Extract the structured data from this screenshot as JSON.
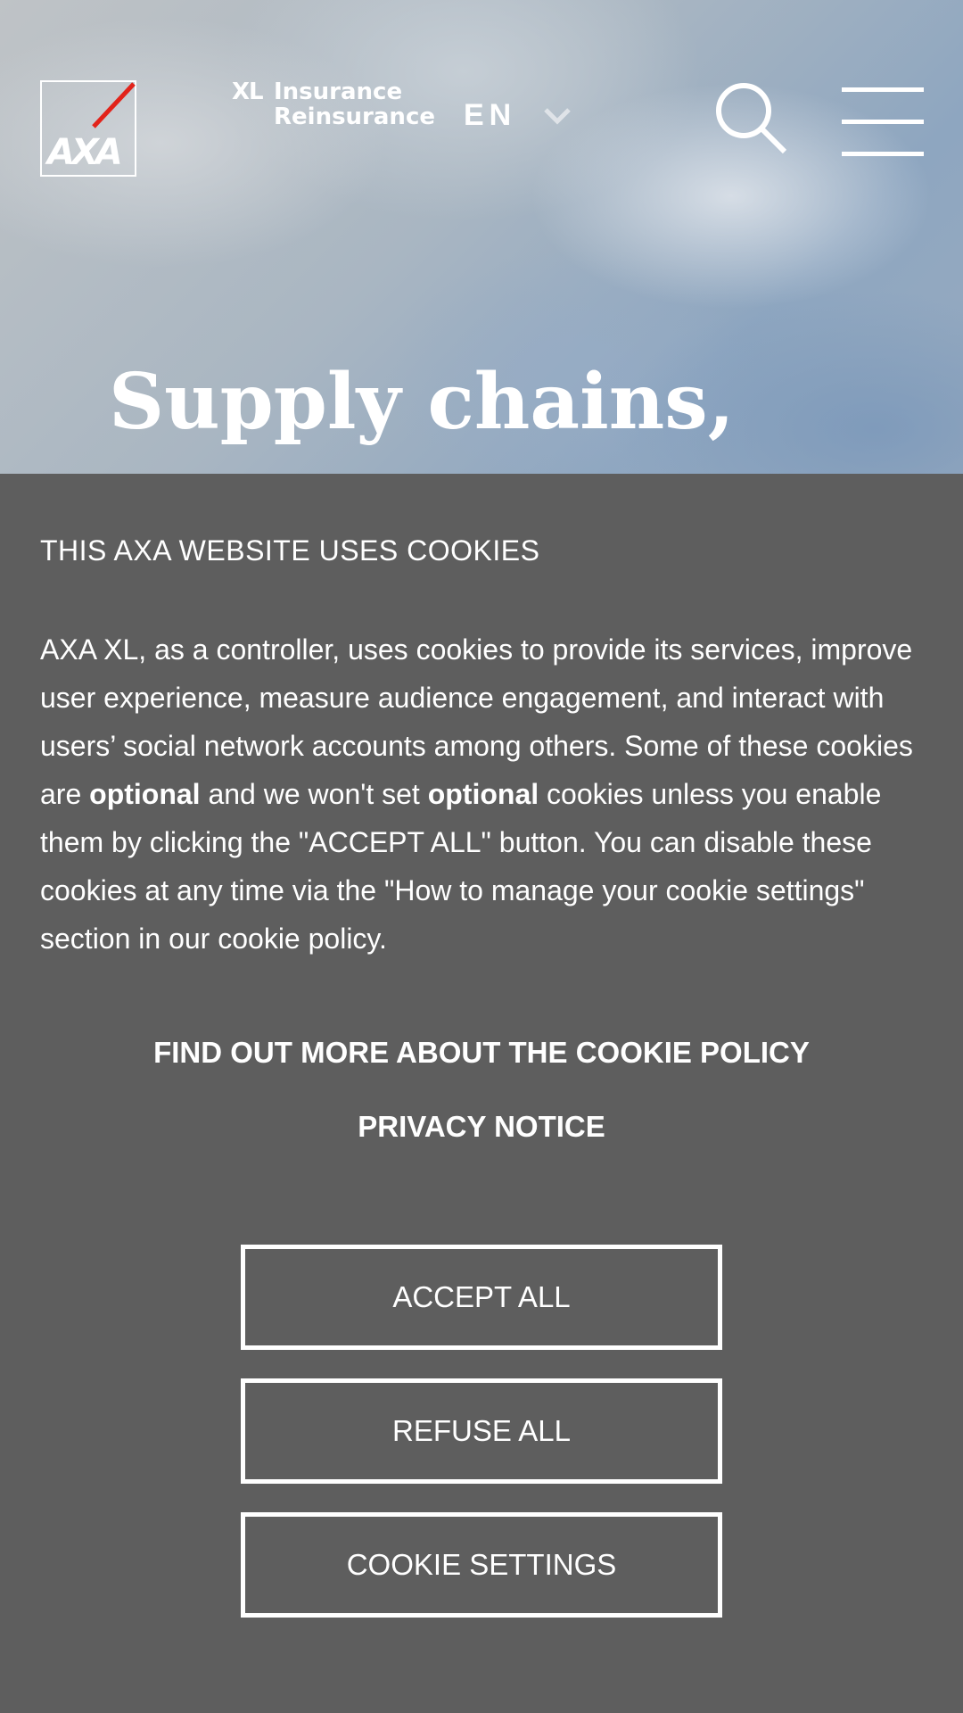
{
  "header": {
    "logo_text": "AXA",
    "logo_accent_color": "#e2231a",
    "brand_mark": "XL",
    "brand_line1": "Insurance",
    "brand_line2": "Reinsurance",
    "language": "EN",
    "language_icon": "chevron-down-icon",
    "search_icon": "search-icon",
    "menu_icon": "hamburger-menu-icon"
  },
  "hero": {
    "title": "Supply chains, inflation and"
  },
  "cookie_banner": {
    "heading": "THIS AXA WEBSITE USES COOKIES",
    "body_part1": "AXA XL, as a controller, uses cookies to provide its services, improve user experience, measure audience engagement, and interact with users’ social network accounts among others. Some of these cookies are ",
    "bold1": "optional",
    "body_part2": " and we won't set ",
    "bold2": "optional",
    "body_part3": " cookies unless you enable them by clicking the \"ACCEPT ALL\" button. You can disable these cookies at any time via the \"How to manage your cookie settings\" section in our cookie policy.",
    "link_cookie_policy": "FIND OUT MORE ABOUT THE COOKIE POLICY",
    "link_privacy": "PRIVACY NOTICE",
    "accept_label": "ACCEPT ALL",
    "refuse_label": "REFUSE ALL",
    "settings_label": "COOKIE SETTINGS",
    "background_color": "#5e5e5e"
  }
}
